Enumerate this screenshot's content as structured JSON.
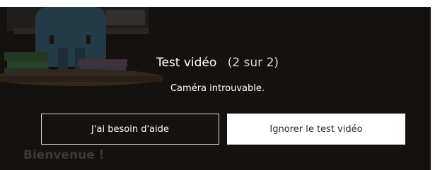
{
  "dialog": {
    "title": "Test vidéo",
    "step": "(2 sur 2)",
    "status": "Caméra introuvable."
  },
  "buttons": {
    "help_label": "J'ai besoin d'aide",
    "skip_label": "Ignorer le test vidéo"
  },
  "background": {
    "welcome_text": "Bienvenue !"
  },
  "colors": {
    "overlay": "#14110f",
    "text": "#ffffff",
    "primary_button_bg": "#ffffff",
    "primary_button_text": "#2b2b2b"
  }
}
